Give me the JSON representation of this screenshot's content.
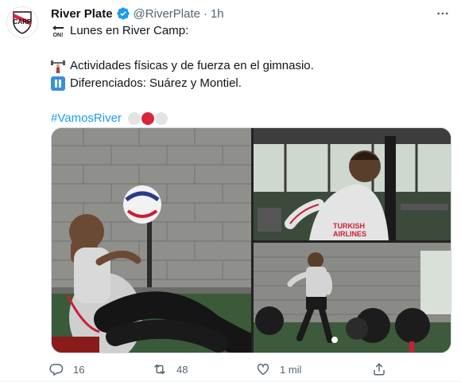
{
  "tweet": {
    "author": {
      "name": "River Plate",
      "handle": "@RiverPlate",
      "time": "1h",
      "verified": true
    },
    "lines": {
      "l1": "Lunes en River Camp:",
      "l2": "Actividades físicas y de fuerza en el gimnasio.",
      "l3": "Diferenciados: Suárez y Montiel."
    },
    "hashtag": "#VamosRiver",
    "flag_colors": [
      "#e3e3e3",
      "#d9253a",
      "#e3e3e3"
    ],
    "stats": {
      "replies": "16",
      "retweets": "48",
      "likes": "1 mil"
    },
    "icons": {
      "reply": "reply-icon",
      "retweet": "retweet-icon",
      "like": "heart-icon",
      "share": "share-icon",
      "more": "more-icon",
      "verified": "verified-badge-icon"
    },
    "colors": {
      "link": "#1d9bf0",
      "muted": "#536471",
      "text": "#0f1419"
    }
  }
}
